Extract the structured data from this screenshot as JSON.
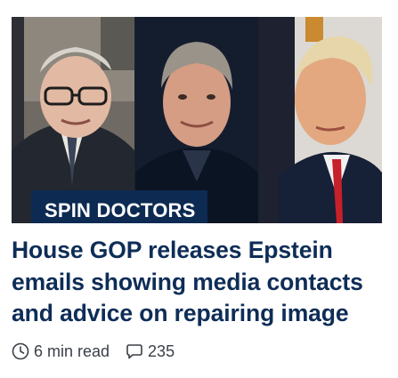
{
  "article": {
    "image_alt": "Three portrait photos side by side",
    "badge_label": "SPIN DOCTORS",
    "headline": "House GOP releases Epstein emails showing media contacts and advice on repairing image",
    "read_time": "6 min read",
    "comment_count": "235"
  },
  "icons": {
    "read_time": "clock-icon",
    "comments": "speech-bubble-icon"
  },
  "colors": {
    "headline": "#0e2d57",
    "badge_background": "#0d2a52",
    "badge_text": "#ffffff",
    "meta_text": "#3a3f47"
  }
}
